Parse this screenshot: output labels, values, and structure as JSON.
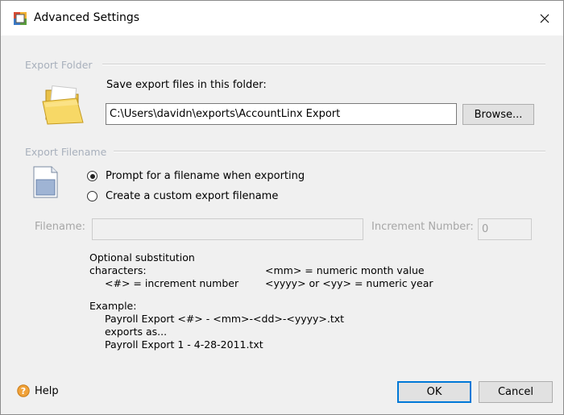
{
  "window": {
    "title": "Advanced Settings"
  },
  "export_folder": {
    "group_label": "Export Folder",
    "prompt": "Save export files in this folder:",
    "path_value": "C:\\Users\\davidn\\exports\\AccountLinx Export",
    "browse_label": "Browse..."
  },
  "export_filename": {
    "group_label": "Export Filename",
    "options": [
      {
        "label": "Prompt for a filename when exporting",
        "selected": true
      },
      {
        "label": "Create a custom export filename",
        "selected": false
      }
    ],
    "filename_label": "Filename:",
    "filename_value": "",
    "increment_label": "Increment Number:",
    "increment_value": "0"
  },
  "help_text": {
    "heading_line1": "Optional substitution",
    "heading_line2": "characters:",
    "sub_increment": "<#> = increment number",
    "sub_month": "<mm> = numeric month value",
    "sub_year": "<yyyy> or <yy> = numeric year",
    "example_label": "Example:",
    "example_pattern": "Payroll Export  <#> - <mm>-<dd>-<yyyy>.txt",
    "exports_as": "exports as...",
    "example_result": "Payroll Export 1 - 4-28-2011.txt"
  },
  "footer": {
    "help_label": "Help",
    "ok_label": "OK",
    "cancel_label": "Cancel"
  }
}
